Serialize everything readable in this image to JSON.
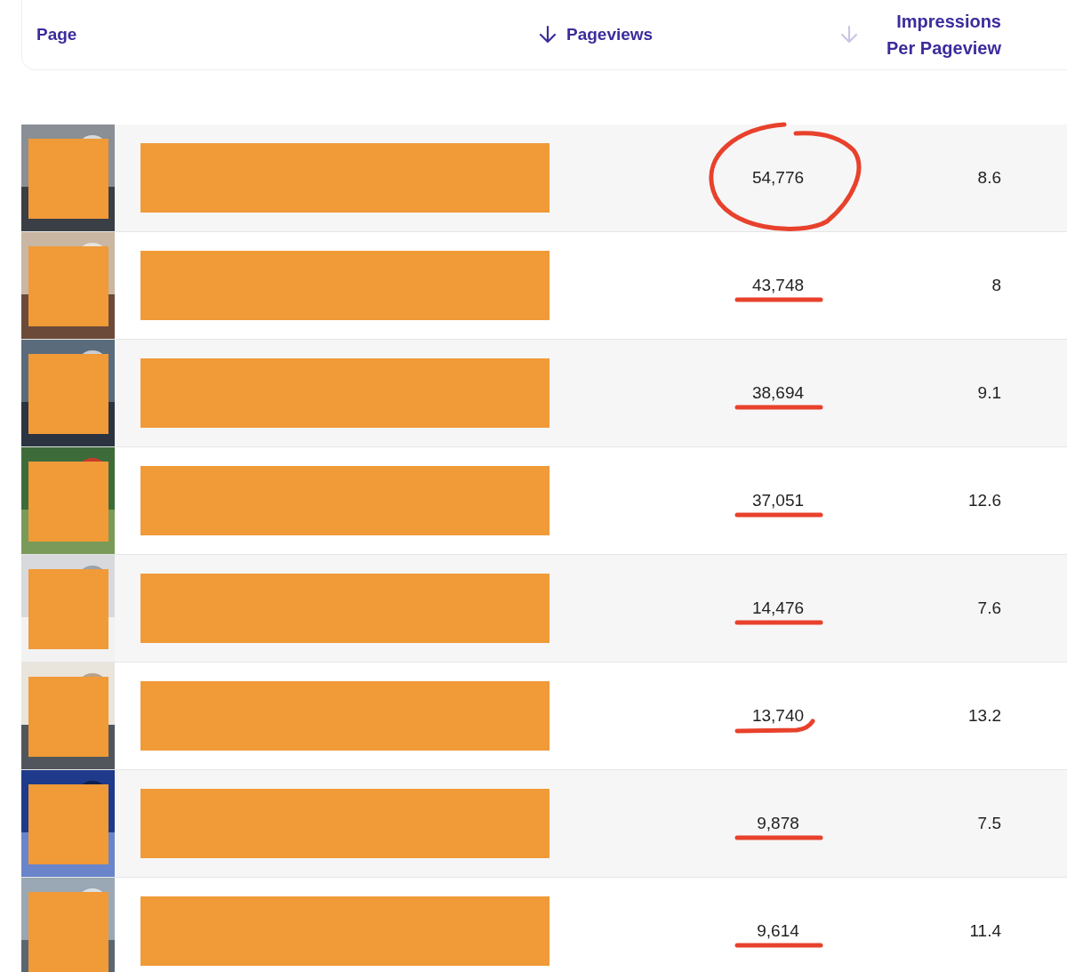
{
  "header": {
    "page_label": "Page",
    "columns": [
      {
        "label": "Pageviews",
        "sorted": true
      },
      {
        "label": "Impressions Per Pageview",
        "sorted": false
      }
    ]
  },
  "rows": [
    {
      "pageviews": "54,776",
      "impressions": "8.6",
      "kind": "circled"
    },
    {
      "pageviews": "43,748",
      "impressions": "8",
      "kind": "underlined"
    },
    {
      "pageviews": "38,694",
      "impressions": "9.1",
      "kind": "underlined"
    },
    {
      "pageviews": "37,051",
      "impressions": "12.6",
      "kind": "underlined"
    },
    {
      "pageviews": "14,476",
      "impressions": "7.6",
      "kind": "underlined"
    },
    {
      "pageviews": "13,740",
      "impressions": "13.2",
      "kind": "hooked"
    },
    {
      "pageviews": "9,878",
      "impressions": "7.5",
      "kind": "underlined"
    },
    {
      "pageviews": "9,614",
      "impressions": "11.4",
      "kind": "underlined"
    }
  ]
}
